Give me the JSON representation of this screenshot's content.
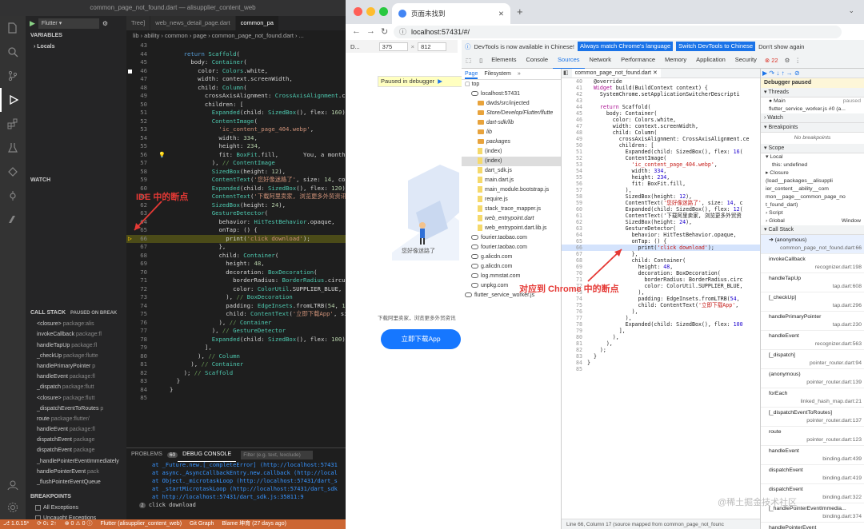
{
  "vscode": {
    "window_title": "common_page_not_found.dart — alisupplier_content_web",
    "debug": {
      "config": "Flutter",
      "tree_label": "Tree]"
    },
    "sidebar": {
      "variables_header": "VARIABLES",
      "locals_label": "Locals",
      "watch_header": "WATCH",
      "callstack_header": "CALL STACK",
      "callstack_status": "PAUSED ON BREAK",
      "callstack": [
        {
          "fn": "<closure>",
          "src": "package:alis"
        },
        {
          "fn": "invokeCallback",
          "src": "package:fl"
        },
        {
          "fn": "handleTapUp",
          "src": "package:fl"
        },
        {
          "fn": "_checkUp",
          "src": "package:flutte"
        },
        {
          "fn": "handlePrimaryPointer",
          "src": "p"
        },
        {
          "fn": "handleEvent",
          "src": "package:fl"
        },
        {
          "fn": "_dispatch",
          "src": "package:flutt"
        },
        {
          "fn": "<closure>",
          "src": "package:flutt"
        },
        {
          "fn": "_dispatchEventToRoutes",
          "src": "p"
        },
        {
          "fn": "route",
          "src": "package:flutter/"
        },
        {
          "fn": "handleEvent",
          "src": "package:fl"
        },
        {
          "fn": "dispatchEvent",
          "src": "package"
        },
        {
          "fn": "dispatchEvent",
          "src": "package"
        },
        {
          "fn": "_handlePointerEventImmediately",
          "src": ""
        },
        {
          "fn": "handlePointerEvent",
          "src": "pack"
        },
        {
          "fn": "_flushPointerEventQueue",
          "src": ""
        }
      ],
      "breakpoints_header": "BREAKPOINTS",
      "breakpoints": [
        {
          "label": "All Exceptions",
          "checked": false
        },
        {
          "label": "Uncaught Exceptions",
          "checked": false
        },
        {
          "label": "common_page_no...",
          "checked": true,
          "line": "66"
        }
      ]
    },
    "tabs": [
      {
        "label": "Tree]",
        "active": false
      },
      {
        "label": "web_news_detail_page.dart",
        "active": false
      },
      {
        "label": "common_pa",
        "active": true
      }
    ],
    "breadcrumb": "lib › ability › common › page › common_page_not_found.dart › ...",
    "code": [
      {
        "n": "43",
        "t": ""
      },
      {
        "n": "44",
        "t": "    return Scaffold("
      },
      {
        "n": "45",
        "t": "      body: Container("
      },
      {
        "n": "46",
        "t": "        color: Colors.white,"
      },
      {
        "n": "47",
        "t": "        width: context.screenWidth,"
      },
      {
        "n": "48",
        "t": "        child: Column("
      },
      {
        "n": "49",
        "t": "          crossAxisAlignment: CrossAxisAlignment.cente"
      },
      {
        "n": "50",
        "t": "          children: ["
      },
      {
        "n": "51",
        "t": "            Expanded(child: SizedBox(), flex: 160),"
      },
      {
        "n": "52",
        "t": "            ContentImage("
      },
      {
        "n": "53",
        "t": "              'ic_content_page_404.webp',"
      },
      {
        "n": "54",
        "t": "              width: 334,"
      },
      {
        "n": "55",
        "t": "              height: 234,"
      },
      {
        "n": "56",
        "t": "              fit: BoxFit.fill,       You, a month ago"
      },
      {
        "n": "57",
        "t": "            ), // ContentImage"
      },
      {
        "n": "58",
        "t": "            SizedBox(height: 12),"
      },
      {
        "n": "59",
        "t": "            ContentText('您好像迷路了', size: 14, color:"
      },
      {
        "n": "60",
        "t": "            Expanded(child: SizedBox(), flex: 120),"
      },
      {
        "n": "61",
        "t": "            ContentText('下载阿里卖家, 浏览更多外贸资讯', s"
      },
      {
        "n": "62",
        "t": "            SizedBox(height: 24),"
      },
      {
        "n": "63",
        "t": "            GestureDetector("
      },
      {
        "n": "64",
        "t": "              behavior: HitTestBehavior.opaque,"
      },
      {
        "n": "65",
        "t": "              onTap: () {"
      },
      {
        "n": "66",
        "t": "                print('click download');"
      },
      {
        "n": "67",
        "t": "              },"
      },
      {
        "n": "68",
        "t": "              child: Container("
      },
      {
        "n": "69",
        "t": "                height: 48,"
      },
      {
        "n": "70",
        "t": "                decoration: BoxDecoration("
      },
      {
        "n": "71",
        "t": "                  borderRadius: BorderRadius.circular("
      },
      {
        "n": "72",
        "t": "                  color: ColorUtil.SUPPLIER_BLUE,"
      },
      {
        "n": "73",
        "t": "                ), // BoxDecoration"
      },
      {
        "n": "74",
        "t": "                padding: EdgeInsets.fromLTRB(54, 12, 5"
      },
      {
        "n": "75",
        "t": "                child: ContentText('立即下载App', size:"
      },
      {
        "n": "76",
        "t": "              ), // Container"
      },
      {
        "n": "77",
        "t": "            ), // GestureDetector"
      },
      {
        "n": "78",
        "t": "            Expanded(child: SizedBox(), flex: 100),"
      },
      {
        "n": "79",
        "t": "          ],"
      },
      {
        "n": "80",
        "t": "        ), // Column"
      },
      {
        "n": "81",
        "t": "      ), // Container"
      },
      {
        "n": "82",
        "t": "    ); // Scaffold"
      },
      {
        "n": "83",
        "t": "  }"
      },
      {
        "n": "84",
        "t": "}"
      },
      {
        "n": "85",
        "t": ""
      }
    ],
    "ide_annotation": "IDE 中的断点",
    "panel": {
      "tabs": [
        "PROBLEMS",
        "60",
        "DEBUG CONSOLE"
      ],
      "filter_placeholder": "Filter (e.g. text, !exclude)",
      "lines": [
        "at _Future.new.[_completeError] (http://localhost:57431",
        "at async._AsyncCallbackEntry.new.callback (http://local",
        "at Object._microtaskLoop (http://localhost:57431/dart_s",
        "at _startMicrotaskLoop (http://localhost:57431/dart_sdk",
        "at http://localhost:57431/dart_sdk.js:35811:9"
      ],
      "output_count": "2",
      "output": "click download"
    },
    "status": [
      "⎇ 1.0.15*",
      "⟳ 0↓ 2↑",
      "⊗ 0 ⚠ 0 ⓘ",
      "Flutter (alisupplier_content_web)",
      "Git Graph",
      "Blame 坤育 (27 days ago)"
    ]
  },
  "chrome": {
    "tab_title": "页面未找到",
    "url": "localhost:57431/#/",
    "device_bar": {
      "device": "D...",
      "width": "375",
      "height": "812"
    },
    "paused_banner": "Paused in debugger",
    "page_text_1": "您好像迷路了",
    "page_text_2": "下载阿里卖家，浏览更多外贸资讯",
    "page_button": "立即下载App",
    "devtools": {
      "info": "DevTools is now available in Chinese!",
      "info_btn_1": "Always match Chrome's language",
      "info_btn_2": "Switch DevTools to Chinese",
      "info_dismiss": "Don't show again",
      "tabs": [
        "Elements",
        "Console",
        "Sources",
        "Network",
        "Performance",
        "Memory",
        "Application",
        "Security"
      ],
      "active_tab": "Sources",
      "error_count": "22",
      "nav_tabs": [
        "Page",
        "Filesystem"
      ],
      "open_file": "common_page_not_found.dart",
      "tree": [
        {
          "label": "top",
          "kind": "top",
          "indent": 0
        },
        {
          "label": "localhost:57431",
          "kind": "cloud",
          "indent": 1
        },
        {
          "label": "dwds/src/injected",
          "kind": "folder",
          "indent": 2
        },
        {
          "label": "Store/Develop/Flutter/flutte",
          "kind": "folder",
          "indent": 2
        },
        {
          "label": "dart-sdk/lib",
          "kind": "folder",
          "indent": 2
        },
        {
          "label": "lib",
          "kind": "folder",
          "indent": 2
        },
        {
          "label": "packages",
          "kind": "folder",
          "indent": 2
        },
        {
          "label": "(index)",
          "kind": "file",
          "indent": 2
        },
        {
          "label": "(index)",
          "kind": "file",
          "indent": 2,
          "selected": true
        },
        {
          "label": "dart_sdk.js",
          "kind": "file",
          "indent": 2
        },
        {
          "label": "main.dart.js",
          "kind": "file",
          "indent": 2
        },
        {
          "label": "main_module.bootstrap.js",
          "kind": "file",
          "indent": 2
        },
        {
          "label": "require.js",
          "kind": "file",
          "indent": 2
        },
        {
          "label": "stack_trace_mapper.js",
          "kind": "file",
          "indent": 2
        },
        {
          "label": "web_entrypoint.dart",
          "kind": "file",
          "indent": 2
        },
        {
          "label": "web_entrypoint.dart.lib.js",
          "kind": "file",
          "indent": 2
        },
        {
          "label": "fourier.taobao.com",
          "kind": "cloud",
          "indent": 1
        },
        {
          "label": "fourier.taobao.com",
          "kind": "cloud",
          "indent": 1
        },
        {
          "label": "g.alicdn.com",
          "kind": "cloud",
          "indent": 1
        },
        {
          "label": "g.alicdn.com",
          "kind": "cloud",
          "indent": 1
        },
        {
          "label": "log.mmstat.com",
          "kind": "cloud",
          "indent": 1
        },
        {
          "label": "unpkg.com",
          "kind": "cloud",
          "indent": 1
        },
        {
          "label": "flutter_service_worker.js",
          "kind": "cloud",
          "indent": 0
        }
      ],
      "source": [
        {
          "n": "40",
          "t": "  @override"
        },
        {
          "n": "41",
          "t": "  Widget build(BuildContext context) {"
        },
        {
          "n": "42",
          "t": "    SystemChrome.setApplicationSwitcherDescripti"
        },
        {
          "n": "43",
          "t": ""
        },
        {
          "n": "44",
          "t": "    return Scaffold("
        },
        {
          "n": "45",
          "t": "      body: Container("
        },
        {
          "n": "46",
          "t": "        color: Colors.white,"
        },
        {
          "n": "47",
          "t": "        width: context.screenWidth,"
        },
        {
          "n": "48",
          "t": "        child: Column("
        },
        {
          "n": "49",
          "t": "          crossAxisAlignment: CrossAxisAlignment.ce"
        },
        {
          "n": "50",
          "t": "          children: ["
        },
        {
          "n": "51",
          "t": "            Expanded(child: SizedBox(), flex: 16("
        },
        {
          "n": "52",
          "t": "            ContentImage("
        },
        {
          "n": "53",
          "t": "              'ic_content_page_404.webp',"
        },
        {
          "n": "54",
          "t": "              width: 334,"
        },
        {
          "n": "55",
          "t": "              height: 234,"
        },
        {
          "n": "56",
          "t": "              fit: BoxFit.fill,"
        },
        {
          "n": "57",
          "t": "            ),"
        },
        {
          "n": "58",
          "t": "            SizedBox(height: 12),"
        },
        {
          "n": "59",
          "t": "            ContentText('您好像迷路了', size: 14, c"
        },
        {
          "n": "60",
          "t": "            Expanded(child: SizedBox(), flex: 12("
        },
        {
          "n": "61",
          "t": "            ContentText('下载阿里卖家, 浏览更多外贸资"
        },
        {
          "n": "62",
          "t": "            SizedBox(height: 24),"
        },
        {
          "n": "63",
          "t": "            GestureDetector("
        },
        {
          "n": "64",
          "t": "              behavior: HitTestBehavior.opaque,"
        },
        {
          "n": "65",
          "t": "              onTap: () {"
        },
        {
          "n": "66",
          "t": "                print('click download');"
        },
        {
          "n": "67",
          "t": "              },"
        },
        {
          "n": "68",
          "t": "              child: Container("
        },
        {
          "n": "69",
          "t": "                height: 48,"
        },
        {
          "n": "70",
          "t": "                decoration: BoxDecoration("
        },
        {
          "n": "71",
          "t": "                  borderRadius: BorderRadius.circ"
        },
        {
          "n": "72",
          "t": "                  color: ColorUtil.SUPPLIER_BLUE,"
        },
        {
          "n": "73",
          "t": "                ),"
        },
        {
          "n": "74",
          "t": "                padding: EdgeInsets.fromLTRB(54,"
        },
        {
          "n": "75",
          "t": "                child: ContentText('立即下载App',"
        },
        {
          "n": "76",
          "t": "              ),"
        },
        {
          "n": "77",
          "t": "            ),"
        },
        {
          "n": "78",
          "t": "            Expanded(child: SizedBox(), flex: 100"
        },
        {
          "n": "79",
          "t": "          ],"
        },
        {
          "n": "80",
          "t": "        ),"
        },
        {
          "n": "81",
          "t": "      ),"
        },
        {
          "n": "82",
          "t": "    );"
        },
        {
          "n": "83",
          "t": "  }"
        },
        {
          "n": "84",
          "t": "}"
        },
        {
          "n": "85",
          "t": ""
        }
      ],
      "chrome_annotation": "对应到 Chrome 中的断点",
      "status_line": "Line 66, Column 17  (source mapped from common_page_not_founc",
      "right": {
        "paused": "Debugger paused",
        "threads_header": "Threads",
        "threads": [
          {
            "name": "Main",
            "state": "paused"
          },
          {
            "name": "flutter_service_worker.js #0 (a...",
            "state": ""
          }
        ],
        "watch_header": "Watch",
        "breakpoints_header": "Breakpoints",
        "no_breakpoints": "No breakpoints",
        "scope_header": "Scope",
        "local_label": "Local",
        "this_line": "this: undefined",
        "closure_lines": [
          "Closure",
          "(load__packages__alisuppli",
          "ier_content__ability__com",
          "mon__page__common_page_no",
          "t_found_dart)"
        ],
        "script_label": "Script",
        "global_label": "Global",
        "global_value": "Window",
        "callstack_header": "Call Stack",
        "callstack": [
          {
            "fn": "(anonymous)",
            "loc": "common_page_not_found.dart:66"
          },
          {
            "fn": "invokeCallback",
            "loc": "recognizer.dart:198"
          },
          {
            "fn": "handleTapUp",
            "loc": "tap.dart:608"
          },
          {
            "fn": "[_checkUp]",
            "loc": "tap.dart:296"
          },
          {
            "fn": "handlePrimaryPointer",
            "loc": "tap.dart:230"
          },
          {
            "fn": "handleEvent",
            "loc": "recognizer.dart:563"
          },
          {
            "fn": "[_dispatch]",
            "loc": "pointer_router.dart:94"
          },
          {
            "fn": "(anonymous)",
            "loc": "pointer_router.dart:139"
          },
          {
            "fn": "forEach",
            "loc": "linked_hash_map.dart:21"
          },
          {
            "fn": "[_dispatchEventToRoutes]",
            "loc": "pointer_router.dart:137"
          },
          {
            "fn": "route",
            "loc": "pointer_router.dart:123"
          },
          {
            "fn": "handleEvent",
            "loc": "binding.dart:439"
          },
          {
            "fn": "dispatchEvent",
            "loc": "binding.dart:419"
          },
          {
            "fn": "dispatchEvent",
            "loc": "binding.dart:322"
          },
          {
            "fn": "[_handlePointerEventImmedia...",
            "loc": "binding.dart:374"
          },
          {
            "fn": "handlePointerEvent",
            "loc": "binding.dart:338"
          },
          {
            "fn": "[_flushPointerEventQueue]",
            "loc": ""
          }
        ]
      }
    },
    "watermark": "@稀土掘金技术社区"
  }
}
